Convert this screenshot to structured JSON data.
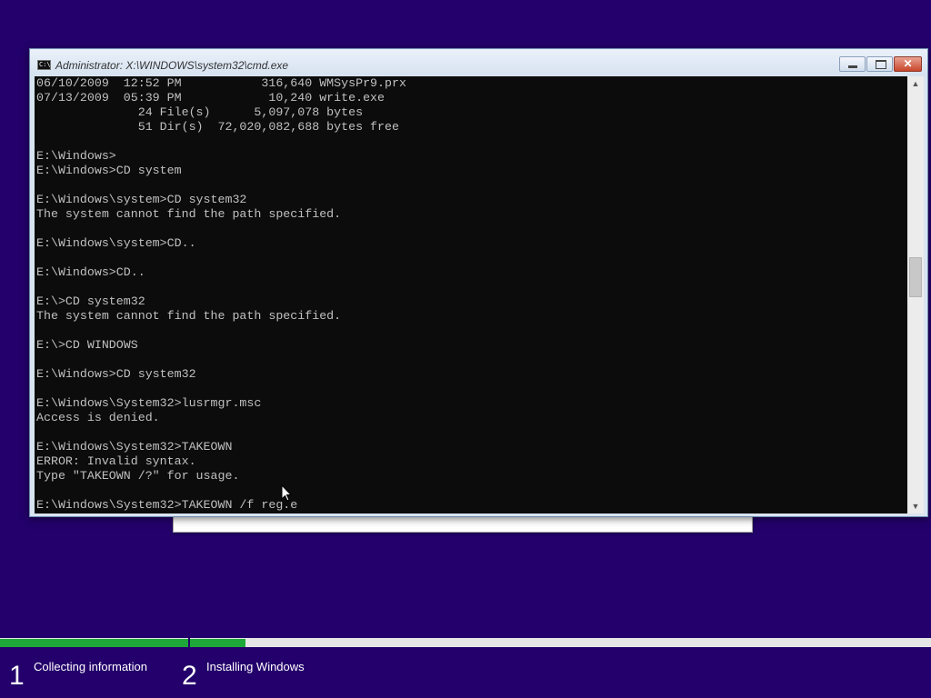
{
  "window": {
    "title": "Administrator: X:\\WINDOWS\\system32\\cmd.exe",
    "icon_text": "C:\\",
    "icon": "cmd-icon",
    "buttons": {
      "minimize": "minimize-icon",
      "maximize": "maximize-icon",
      "close": "close-icon",
      "close_glyph": "✕"
    }
  },
  "console": {
    "lines": [
      "06/10/2009  12:52 PM           316,640 WMSysPr9.prx",
      "07/13/2009  05:39 PM            10,240 write.exe",
      "              24 File(s)      5,097,078 bytes",
      "              51 Dir(s)  72,020,082,688 bytes free",
      "",
      "E:\\Windows>",
      "E:\\Windows>CD system",
      "",
      "E:\\Windows\\system>CD system32",
      "The system cannot find the path specified.",
      "",
      "E:\\Windows\\system>CD..",
      "",
      "E:\\Windows>CD..",
      "",
      "E:\\>CD system32",
      "The system cannot find the path specified.",
      "",
      "E:\\>CD WINDOWS",
      "",
      "E:\\Windows>CD system32",
      "",
      "E:\\Windows\\System32>lusrmgr.msc",
      "Access is denied.",
      "",
      "E:\\Windows\\System32>TAKEOWN",
      "ERROR: Invalid syntax.",
      "Type \"TAKEOWN /?\" for usage.",
      "",
      "E:\\Windows\\System32>TAKEOWN /f reg.e"
    ]
  },
  "scrollbar": {
    "up_glyph": "▲",
    "down_glyph": "▼"
  },
  "setup": {
    "steps": [
      {
        "number": "1",
        "label": "Collecting information"
      },
      {
        "number": "2",
        "label": "Installing Windows"
      }
    ],
    "progress": {
      "collecting_information": 1.0,
      "installing_windows": 0.075
    },
    "colors": {
      "background": "#23006b",
      "progress_fill": "#1fa83a",
      "progress_track": "#e6e6e6"
    }
  }
}
